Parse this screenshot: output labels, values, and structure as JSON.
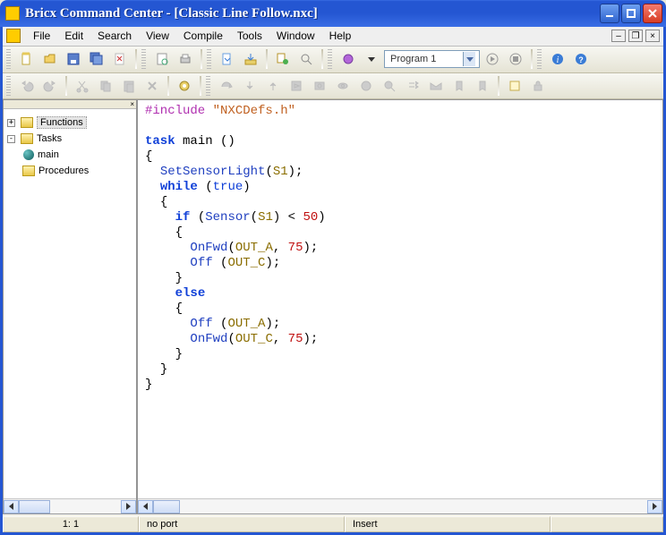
{
  "window": {
    "title": "Bricx Command Center - [Classic Line Follow.nxc]"
  },
  "menu": {
    "items": [
      "File",
      "Edit",
      "Search",
      "View",
      "Compile",
      "Tools",
      "Window",
      "Help"
    ]
  },
  "toolbar1": {
    "program_selector": "Program 1",
    "icons": [
      "new-file",
      "open-file",
      "save",
      "save-all",
      "print-preview",
      "print",
      "compile",
      "download",
      "run",
      "stop",
      "find",
      "dropdown",
      "program",
      "go",
      "go-small",
      "help-info",
      "help-q"
    ]
  },
  "toolbar2": {
    "icons": [
      "undo",
      "redo",
      "cut",
      "copy",
      "paste",
      "delete",
      "properties",
      "indent",
      "outdent",
      "step-over",
      "step-into",
      "step-out",
      "breakpoint",
      "watch",
      "toggle-bp",
      "find2",
      "replace",
      "bookmark",
      "next-bm",
      "prev-bm",
      "notes",
      "lock"
    ]
  },
  "tree": {
    "nodes": [
      {
        "label": "Functions",
        "type": "folder",
        "indent": 0,
        "selected": true,
        "box": "+"
      },
      {
        "label": "Tasks",
        "type": "folder",
        "indent": 0,
        "box": "-"
      },
      {
        "label": "main",
        "type": "task",
        "indent": 1
      },
      {
        "label": "Procedures",
        "type": "folder",
        "indent": 0,
        "box": ""
      }
    ]
  },
  "code": {
    "include": "#include",
    "include_file": "\"NXCDefs.h\"",
    "task": "task",
    "main": "main",
    "paren": "()",
    "ob": "{",
    "cb": "}",
    "setlight": "SetSensorLight",
    "s1": "S1",
    "while": "while",
    "true": "true",
    "if": "if",
    "sensor": "Sensor",
    "lt50": "< 50",
    "onfwd": "OnFwd",
    "off": "Off",
    "outa": "OUT_A",
    "outc": "OUT_C",
    "n75": "75",
    "n50": "50",
    "else": "else"
  },
  "status": {
    "position": "1:  1",
    "port": "no port",
    "mode": "Insert"
  }
}
